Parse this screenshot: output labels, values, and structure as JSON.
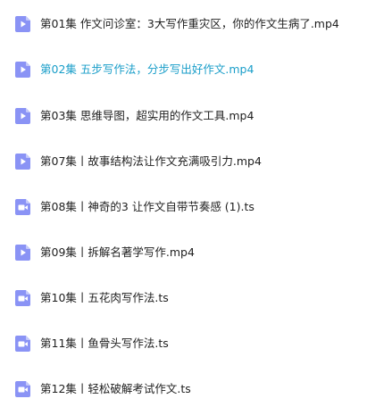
{
  "files": [
    {
      "name": "第01集 作文问诊室：3大写作重灾区，你的作文生病了.mp4",
      "icon": "video-play-icon",
      "highlighted": false
    },
    {
      "name": "第02集 五步写作法，分步写出好作文.mp4",
      "icon": "video-play-icon",
      "highlighted": true
    },
    {
      "name": "第03集 思维导图，超实用的作文工具.mp4",
      "icon": "video-play-icon",
      "highlighted": false
    },
    {
      "name": "第07集丨故事结构法让作文充满吸引力.mp4",
      "icon": "video-play-icon",
      "highlighted": false
    },
    {
      "name": "第08集丨神奇的3 让作文自带节奏感 (1).ts",
      "icon": "video-camera-icon",
      "highlighted": false
    },
    {
      "name": "第09集丨拆解名著学写作.mp4",
      "icon": "video-play-icon",
      "highlighted": false
    },
    {
      "name": "第10集丨五花肉写作法.ts",
      "icon": "video-camera-icon",
      "highlighted": false
    },
    {
      "name": "第11集丨鱼骨头写作法.ts",
      "icon": "video-camera-icon",
      "highlighted": false
    },
    {
      "name": "第12集丨轻松破解考试作文.ts",
      "icon": "video-camera-icon",
      "highlighted": false
    }
  ],
  "colors": {
    "icon_fill": "#8a93f5",
    "icon_fold": "#c3c8fa",
    "text": "#1f1f1f",
    "highlight_text": "#1a9ec9"
  }
}
